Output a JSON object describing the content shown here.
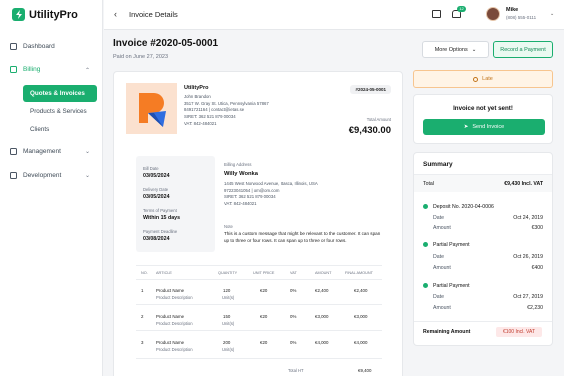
{
  "app": {
    "name": "UtilityPro"
  },
  "sidebar": {
    "items": [
      {
        "label": "Dashboard"
      },
      {
        "label": "Billing"
      },
      {
        "label": "Management"
      },
      {
        "label": "Development"
      }
    ],
    "billing_sub": [
      {
        "label": "Quotes & Invoices"
      },
      {
        "label": "Products & Services"
      },
      {
        "label": "Clients"
      }
    ]
  },
  "header": {
    "title": "Invoice Details",
    "notif_count": "12",
    "user_name": "Mike",
    "user_phone": "(808) 555-0111"
  },
  "invoice": {
    "title": "Invoice #2020-05-0001",
    "paid_on": "Paid on June 27, 2023",
    "more_options": "More Options",
    "record_payment": "Record a Payment",
    "company": "UtilityPro",
    "company_contact": "John Brandon",
    "company_address": "3517 W. Gray St. Utica, Pennsylvania 57867",
    "company_phone_email": "8491721164 | contact@ietas.se",
    "company_siret": "SIRET: 362 521 879 00034",
    "company_vat": "VAT: 842-484021",
    "number_badge": "#2024-05-0001",
    "total_label": "Total Amount",
    "total_value": "€9,430.00",
    "bill_date_label": "Bill Date",
    "bill_date": "03/05/2024",
    "delivery_label": "Delivery Date",
    "delivery_date": "03/05/2024",
    "terms_label": "Terms of Payment",
    "terms": "Within 15 days",
    "deadline_label": "Payment Deadline",
    "deadline": "03/08/2024",
    "billing_label": "Billing Address",
    "client_name": "Willy Wonka",
    "client_address": "1445 West Norwood Avenue, Itasca, Illinois, USA",
    "client_phone_email": "97223041054 | om@om.com",
    "client_siret": "SIRET: 362 521 879 00034",
    "client_vat": "VAT: 842-484021",
    "note_label": "Note",
    "note": "This is a custom message that might be relevant to the customer. It can span up to three or four rows. It can span up to three or four rows.",
    "table_headers": [
      "NO.",
      "ARTICLE",
      "QUANTITY",
      "UNIT PRICE",
      "VAT",
      "AMOUNT",
      "FINAL AMOUNT"
    ],
    "rows": [
      {
        "no": "1",
        "name": "Product Name",
        "desc": "Product Description",
        "qty": "120",
        "unit": "Unit(s)",
        "price": "€20",
        "vat": "0%",
        "amount": "€2,400",
        "final": "€2,400"
      },
      {
        "no": "2",
        "name": "Product Name",
        "desc": "Product Description",
        "qty": "150",
        "unit": "Unit(s)",
        "price": "€20",
        "vat": "0%",
        "amount": "€3,000",
        "final": "€3,000"
      },
      {
        "no": "3",
        "name": "Product Name",
        "desc": "Product Description",
        "qty": "200",
        "unit": "Unit(s)",
        "price": "€20",
        "vat": "0%",
        "amount": "€4,000",
        "final": "€4,000"
      }
    ],
    "total_ht_label": "Total HT",
    "total_ht": "€9,400"
  },
  "status": {
    "late": "Late",
    "not_sent": "Invoice not yet sent!",
    "send_invoice": "Send Invoice"
  },
  "summary": {
    "title": "Summary",
    "total_label": "Total",
    "total_value": "€9,430 Incl. VAT",
    "payments": [
      {
        "title": "Deposit No. 2020-04-0006",
        "date_label": "Date",
        "date": "Oct 24, 2019",
        "amount_label": "Amount",
        "amount": "€300"
      },
      {
        "title": "Partial Payment",
        "date_label": "Date",
        "date": "Oct 26, 2019",
        "amount_label": "Amount",
        "amount": "€400"
      },
      {
        "title": "Partial Payment",
        "date_label": "Date",
        "date": "Oct 27, 2019",
        "amount_label": "Amount",
        "amount": "€2,230"
      }
    ],
    "remaining_label": "Remaining Amount",
    "remaining_value": "€100 Incl. VAT"
  },
  "colors": {
    "accent": "#1aae6f",
    "late": "#c2741a",
    "danger": "#c0392b"
  }
}
